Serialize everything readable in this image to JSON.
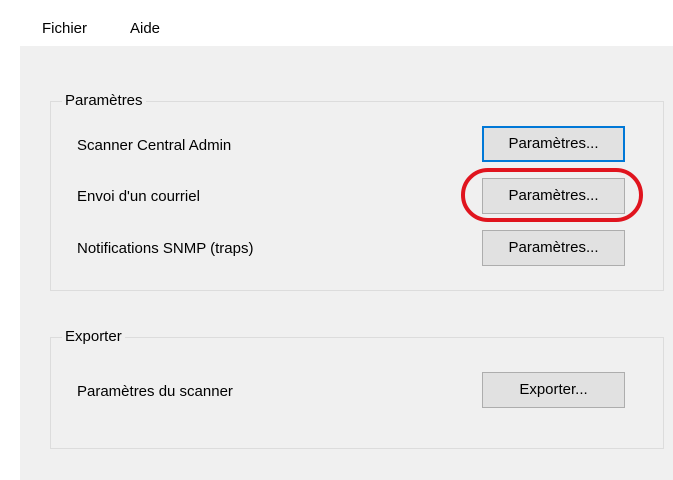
{
  "menu": {
    "file": "Fichier",
    "help": "Aide"
  },
  "settings_group": {
    "title": "Paramètres",
    "rows": [
      {
        "label": "Scanner Central Admin",
        "button": "Paramètres..."
      },
      {
        "label": "Envoi d'un courriel",
        "button": "Paramètres..."
      },
      {
        "label": "Notifications SNMP (traps)",
        "button": "Paramètres..."
      }
    ]
  },
  "export_group": {
    "title": "Exporter",
    "rows": [
      {
        "label": "Paramètres du scanner",
        "button": "Exporter..."
      }
    ]
  },
  "annotation": {
    "highlight_color": "#e0141e",
    "highlighted": "email-settings-button"
  },
  "colors": {
    "focus_border": "#0078d7",
    "panel_background": "#f0f0f0",
    "button_background": "#e1e1e1"
  }
}
